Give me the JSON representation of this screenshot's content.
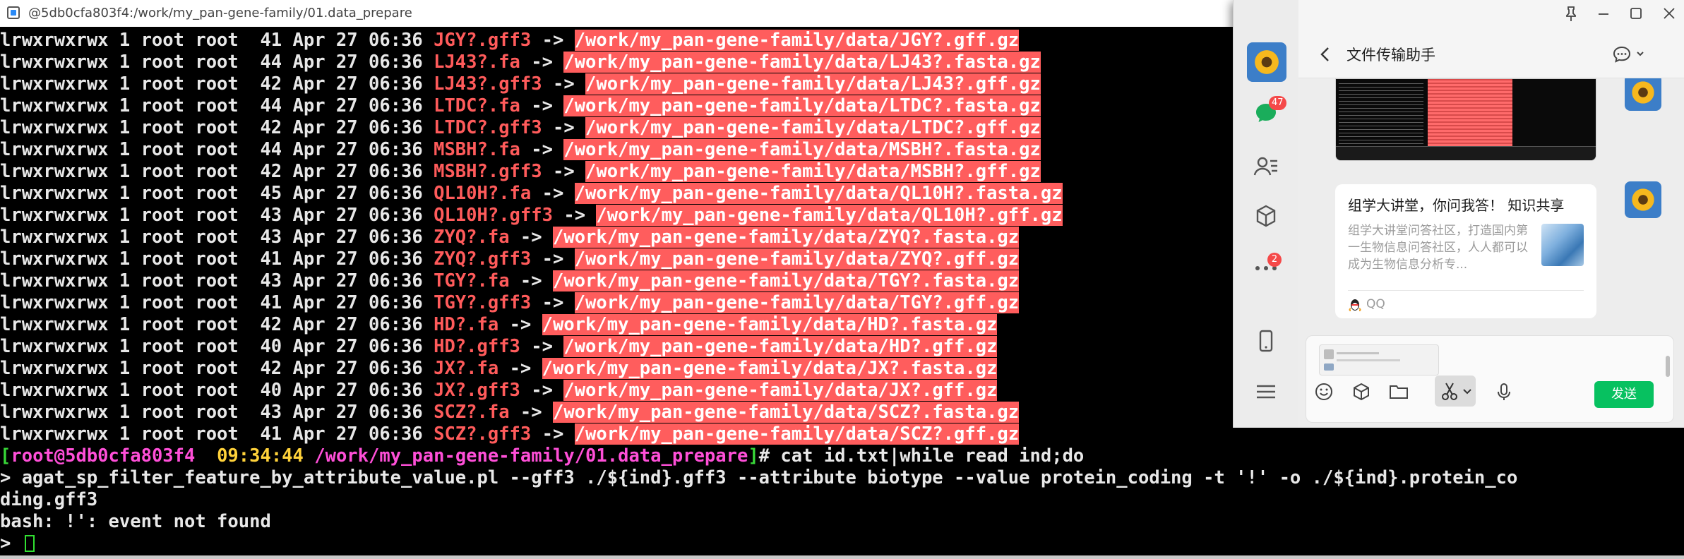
{
  "terminal": {
    "title": "@5db0cfa803f4:/work/my_pan-gene-family/01.data_prepare",
    "listing": [
      {
        "perm": "lrwxrwxrwx 1 root root  41 Apr 27 06:36 ",
        "name": "JGY?.gff3",
        "target": "/work/my_pan-gene-family/data/JGY?.gff.gz"
      },
      {
        "perm": "lrwxrwxrwx 1 root root  44 Apr 27 06:36 ",
        "name": "LJ43?.fa",
        "target": "/work/my_pan-gene-family/data/LJ43?.fasta.gz"
      },
      {
        "perm": "lrwxrwxrwx 1 root root  42 Apr 27 06:36 ",
        "name": "LJ43?.gff3",
        "target": "/work/my_pan-gene-family/data/LJ43?.gff.gz"
      },
      {
        "perm": "lrwxrwxrwx 1 root root  44 Apr 27 06:36 ",
        "name": "LTDC?.fa",
        "target": "/work/my_pan-gene-family/data/LTDC?.fasta.gz"
      },
      {
        "perm": "lrwxrwxrwx 1 root root  42 Apr 27 06:36 ",
        "name": "LTDC?.gff3",
        "target": "/work/my_pan-gene-family/data/LTDC?.gff.gz"
      },
      {
        "perm": "lrwxrwxrwx 1 root root  44 Apr 27 06:36 ",
        "name": "MSBH?.fa",
        "target": "/work/my_pan-gene-family/data/MSBH?.fasta.gz"
      },
      {
        "perm": "lrwxrwxrwx 1 root root  42 Apr 27 06:36 ",
        "name": "MSBH?.gff3",
        "target": "/work/my_pan-gene-family/data/MSBH?.gff.gz"
      },
      {
        "perm": "lrwxrwxrwx 1 root root  45 Apr 27 06:36 ",
        "name": "QL10H?.fa",
        "target": "/work/my_pan-gene-family/data/QL10H?.fasta.gz"
      },
      {
        "perm": "lrwxrwxrwx 1 root root  43 Apr 27 06:36 ",
        "name": "QL10H?.gff3",
        "target": "/work/my_pan-gene-family/data/QL10H?.gff.gz"
      },
      {
        "perm": "lrwxrwxrwx 1 root root  43 Apr 27 06:36 ",
        "name": "ZYQ?.fa",
        "target": "/work/my_pan-gene-family/data/ZYQ?.fasta.gz"
      },
      {
        "perm": "lrwxrwxrwx 1 root root  41 Apr 27 06:36 ",
        "name": "ZYQ?.gff3",
        "target": "/work/my_pan-gene-family/data/ZYQ?.gff.gz"
      },
      {
        "perm": "lrwxrwxrwx 1 root root  43 Apr 27 06:36 ",
        "name": "TGY?.fa",
        "target": "/work/my_pan-gene-family/data/TGY?.fasta.gz"
      },
      {
        "perm": "lrwxrwxrwx 1 root root  41 Apr 27 06:36 ",
        "name": "TGY?.gff3",
        "target": "/work/my_pan-gene-family/data/TGY?.gff.gz"
      },
      {
        "perm": "lrwxrwxrwx 1 root root  42 Apr 27 06:36 ",
        "name": "HD?.fa",
        "target": "/work/my_pan-gene-family/data/HD?.fasta.gz"
      },
      {
        "perm": "lrwxrwxrwx 1 root root  40 Apr 27 06:36 ",
        "name": "HD?.gff3",
        "target": "/work/my_pan-gene-family/data/HD?.gff.gz"
      },
      {
        "perm": "lrwxrwxrwx 1 root root  42 Apr 27 06:36 ",
        "name": "JX?.fa",
        "target": "/work/my_pan-gene-family/data/JX?.fasta.gz"
      },
      {
        "perm": "lrwxrwxrwx 1 root root  40 Apr 27 06:36 ",
        "name": "JX?.gff3",
        "target": "/work/my_pan-gene-family/data/JX?.gff.gz"
      },
      {
        "perm": "lrwxrwxrwx 1 root root  43 Apr 27 06:36 ",
        "name": "SCZ?.fa",
        "target": "/work/my_pan-gene-family/data/SCZ?.fasta.gz"
      },
      {
        "perm": "lrwxrwxrwx 1 root root  41 Apr 27 06:36 ",
        "name": "SCZ?.gff3",
        "target": "/work/my_pan-gene-family/data/SCZ?.gff.gz"
      }
    ],
    "arrow": " -> ",
    "prompt": {
      "open": "[",
      "host": "root@5db0cfa803f4",
      "time": "  09:34:44",
      "path": " /work/my_pan-gene-family/01.data_prepare",
      "close": "]",
      "hash": "# ",
      "command": "cat id.txt|while read ind;do"
    },
    "continuation_1": "> agat_sp_filter_feature_by_attribute_value.pl --gff3 ./${ind}.gff3 --attribute biotype --value protein_coding -t '!' -o ./${ind}.protein_co",
    "continuation_2": "ding.gff3",
    "error": "bash: !': event not found",
    "last_prompt": "> "
  },
  "wechat": {
    "chat_title": "文件传输助手",
    "badges": {
      "chats": "47",
      "more": "2"
    },
    "card": {
      "title": "组学大讲堂，你问我答！ 知识共享",
      "description": "组学大讲堂问答社区，打造国内第一生物信息问答社区，人人都可以成为生物信息分析专...",
      "source": "QQ"
    },
    "send_label": "发送"
  },
  "colors": {
    "terminal_bg": "#000000",
    "symlink_name": "#ff5b5b",
    "symlink_target_bg": "#ff5d5d",
    "prompt_bracket": "#38d838",
    "prompt_host": "#ff4fd8",
    "prompt_time": "#ffd23a",
    "wechat_send": "#07c160"
  },
  "icons": [
    "terminal-app-icon",
    "chat-icon",
    "contacts-icon",
    "cube-icon",
    "more-dots-icon",
    "phone-icon",
    "menu-icon",
    "pin-icon",
    "minimize-icon",
    "maximize-icon",
    "close-icon",
    "back-arrow-icon",
    "chat-options-icon",
    "emoji-icon",
    "favorites-icon",
    "folder-icon",
    "scissors-icon",
    "microphone-icon",
    "qq-icon"
  ]
}
